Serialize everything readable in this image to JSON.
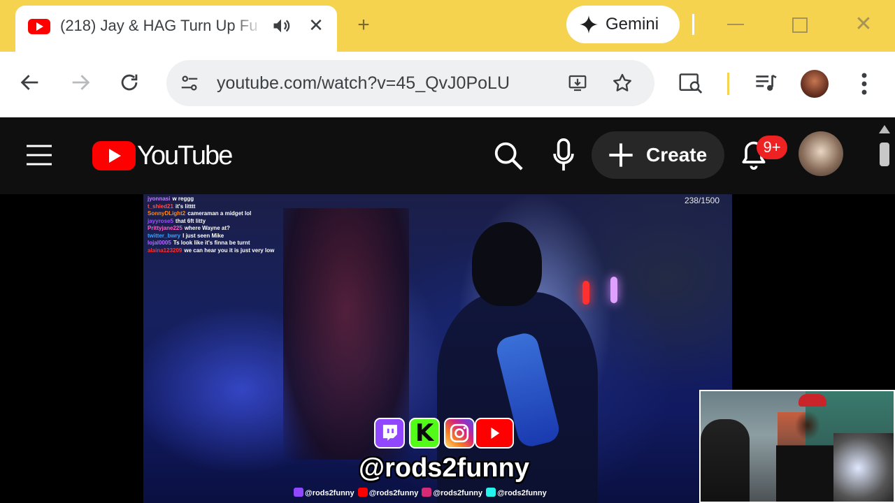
{
  "browser": {
    "tab": {
      "title": "(218) Jay & HAG Turn Up Fu",
      "favicon": "youtube-favicon-icon",
      "audio_icon": "speaker-icon",
      "close_icon": "close-icon"
    },
    "new_tab_glyph": "+",
    "gemini": {
      "label": "Gemini",
      "icon": "gemini-sparkle-icon"
    },
    "window_controls": [
      "minimize-icon",
      "maximize-icon",
      "close-icon"
    ],
    "omnibox": {
      "url": "youtube.com/watch?v=45_QvJ0PoLU",
      "site_info_icon": "tune-icon",
      "install_icon": "install-app-icon",
      "bookmark_icon": "star-icon"
    },
    "toolbar_icons": [
      "back-icon",
      "forward-icon",
      "reload-icon",
      "google-lens-icon",
      "media-controls-icon",
      "profile-avatar",
      "kebab-menu-icon"
    ],
    "accent_color": "#f6d34f"
  },
  "youtube": {
    "wordmark": "YouTube",
    "create_label": "Create",
    "notification_badge": "9+",
    "icons": [
      "hamburger-menu-icon",
      "search-icon",
      "microphone-icon",
      "plus-icon",
      "bell-icon"
    ],
    "brand_color": "#ff0000"
  },
  "video": {
    "viewer_count": "238/1500",
    "chat": [
      {
        "user": "jyonnasi",
        "text": "w reggg",
        "color": "#c57dff"
      },
      {
        "user": "t_shied21",
        "text": "it's litttt",
        "color": "#ff4d4d"
      },
      {
        "user": "SonnyDLight2",
        "text": "cameraman a midget lol",
        "color": "#ff8a1c"
      },
      {
        "user": "jayyrose5",
        "text": "that 6ft litty",
        "color": "#a050ff"
      },
      {
        "user": "Prittyjane225",
        "text": "where Wayne at?",
        "color": "#ff60c8"
      },
      {
        "user": "twitter_bwry",
        "text": "I just seen Mike",
        "color": "#3aa0ff"
      },
      {
        "user": "lojal0005",
        "text": "Ts look like it's finna be turnt",
        "color": "#b06cff"
      },
      {
        "user": "alaina123209",
        "text": "we can hear you it is just very low",
        "color": "#ff3030"
      }
    ],
    "overlay": {
      "handle": "@rods2funny",
      "social_icons": [
        "twitch-icon",
        "kick-icon",
        "instagram-icon",
        "youtube-icon"
      ],
      "kick_letter": "K",
      "handles_row": [
        {
          "icon": "twitch-icon",
          "text": "@rods2funny",
          "color": "#9147ff"
        },
        {
          "icon": "youtube-icon",
          "text": "@rods2funny",
          "color": "#ff0000"
        },
        {
          "icon": "instagram-icon",
          "text": "@rods2funny",
          "color": "#d62976"
        },
        {
          "icon": "tiktok-icon",
          "text": "@rods2funny",
          "color": "#25f4ee"
        }
      ]
    }
  }
}
